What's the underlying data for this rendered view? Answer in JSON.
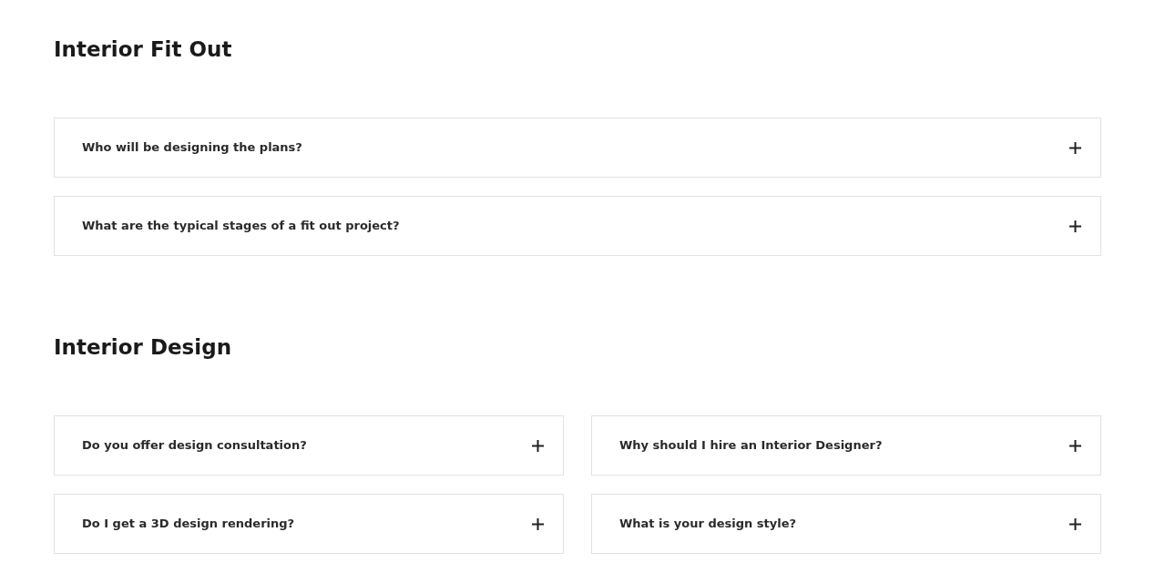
{
  "sections": [
    {
      "title": "Interior Fit Out",
      "kind": "list",
      "items": [
        {
          "question": "Who will be designing the plans?",
          "expanded": false
        },
        {
          "question": "What are the typical stages of a fit out project?",
          "expanded": false
        }
      ]
    },
    {
      "title": "Interior Design",
      "kind": "grid",
      "items": [
        {
          "question": "Do you offer design consultation?",
          "expanded": false
        },
        {
          "question": "Why should I hire an Interior Designer?",
          "expanded": false
        },
        {
          "question": "Do I get a 3D design rendering?",
          "expanded": false
        },
        {
          "question": "What is your design style?",
          "expanded": false
        }
      ]
    }
  ]
}
